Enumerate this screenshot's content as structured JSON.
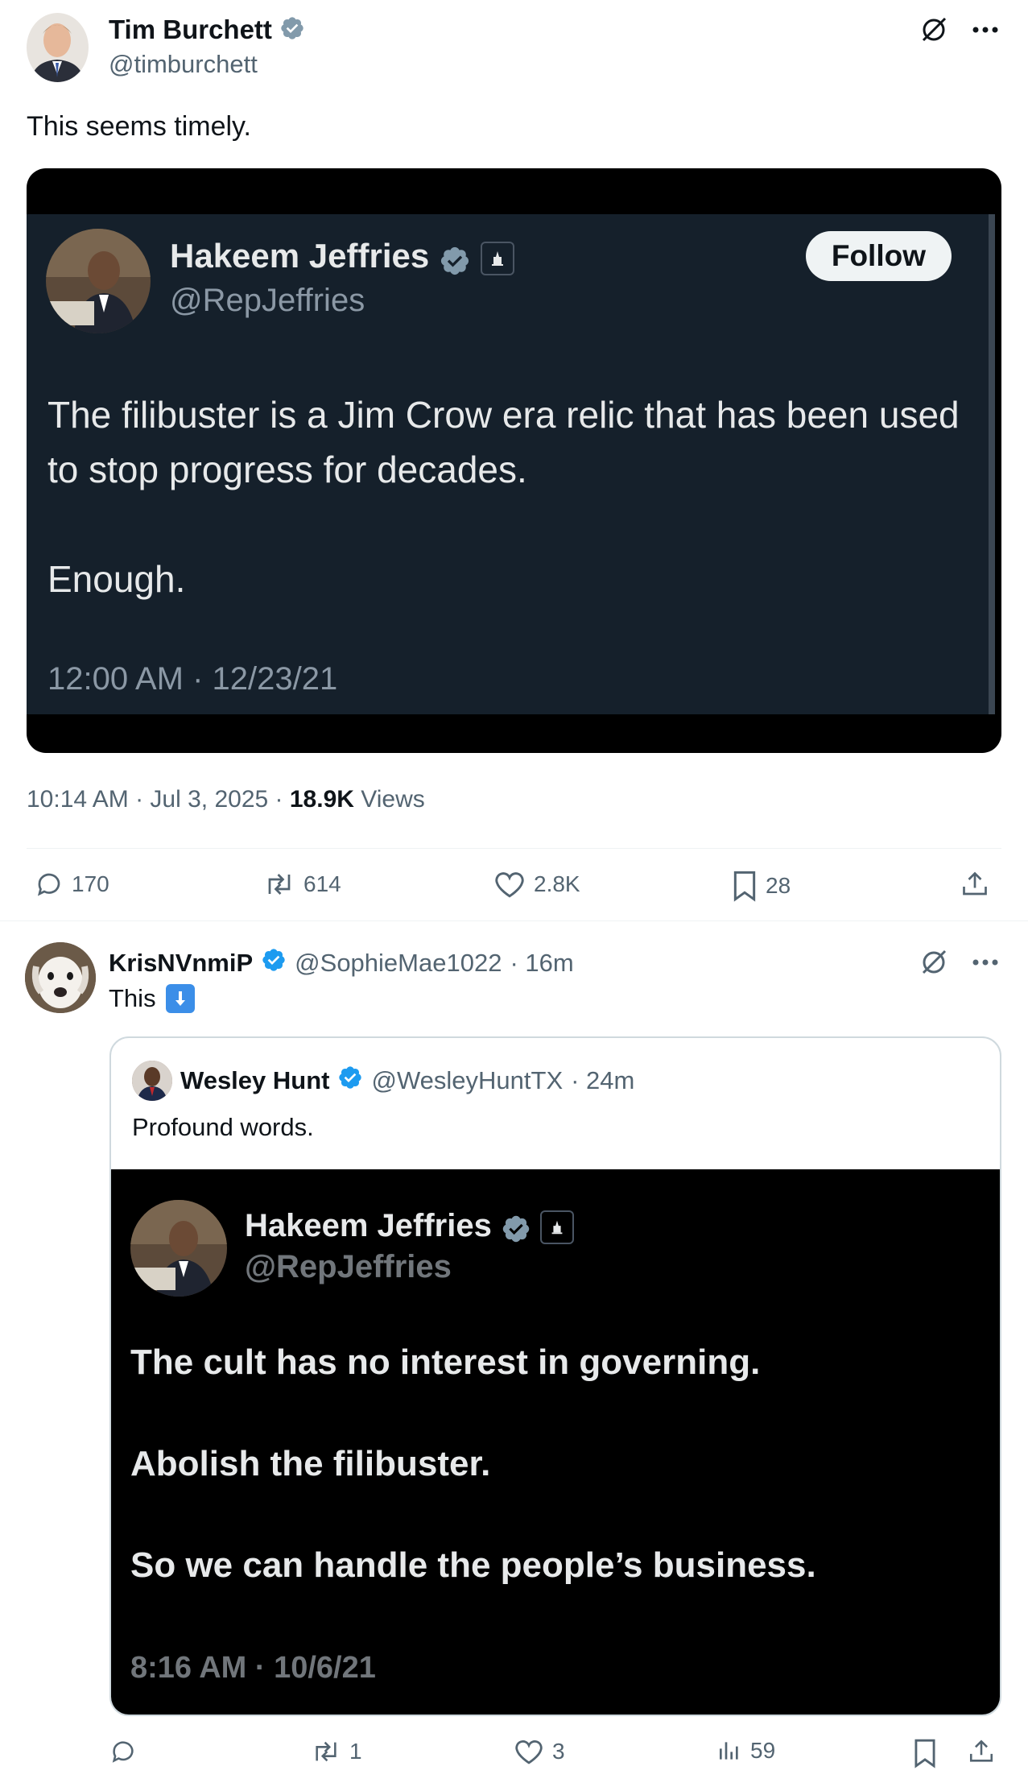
{
  "main_tweet": {
    "author_name": "Tim Burchett",
    "author_handle": "@timburchett",
    "text": "This seems timely.",
    "embedded": {
      "name": "Hakeem Jeffries",
      "handle": "@RepJeffries",
      "follow_label": "Follow",
      "body": "The filibuster is a Jim Crow era relic that has been used to stop progress for decades.\n\nEnough.",
      "timestamp": "12:00 AM · 12/23/21"
    },
    "meta": {
      "time": "10:14 AM · Jul 3, 2025 · ",
      "views_count": "18.9K",
      "views_label": " Views"
    },
    "actions": {
      "replies": "170",
      "reposts": "614",
      "likes": "2.8K",
      "bookmarks": "28"
    }
  },
  "reply_tweet": {
    "author_name": "KrisNVnmiP",
    "author_handle": "@SophieMae1022",
    "time": "· 16m",
    "text": "This",
    "quote": {
      "name": "Wesley Hunt",
      "handle": "@WesleyHuntTX",
      "time": "· 24m",
      "text": "Profound words.",
      "image": {
        "name": "Hakeem Jeffries",
        "handle": "@RepJeffries",
        "body": "The cult has no interest in governing.\n\nAbolish the filibuster.\n\nSo we can handle the people’s business.",
        "timestamp": "8:16 AM · 10/6/21"
      }
    },
    "actions": {
      "reposts": "1",
      "likes": "3",
      "views": "59"
    }
  },
  "colors": {
    "verified_blue": "#1d9bf0",
    "verified_gray": "#829aab",
    "dark_card": "#15202b"
  }
}
